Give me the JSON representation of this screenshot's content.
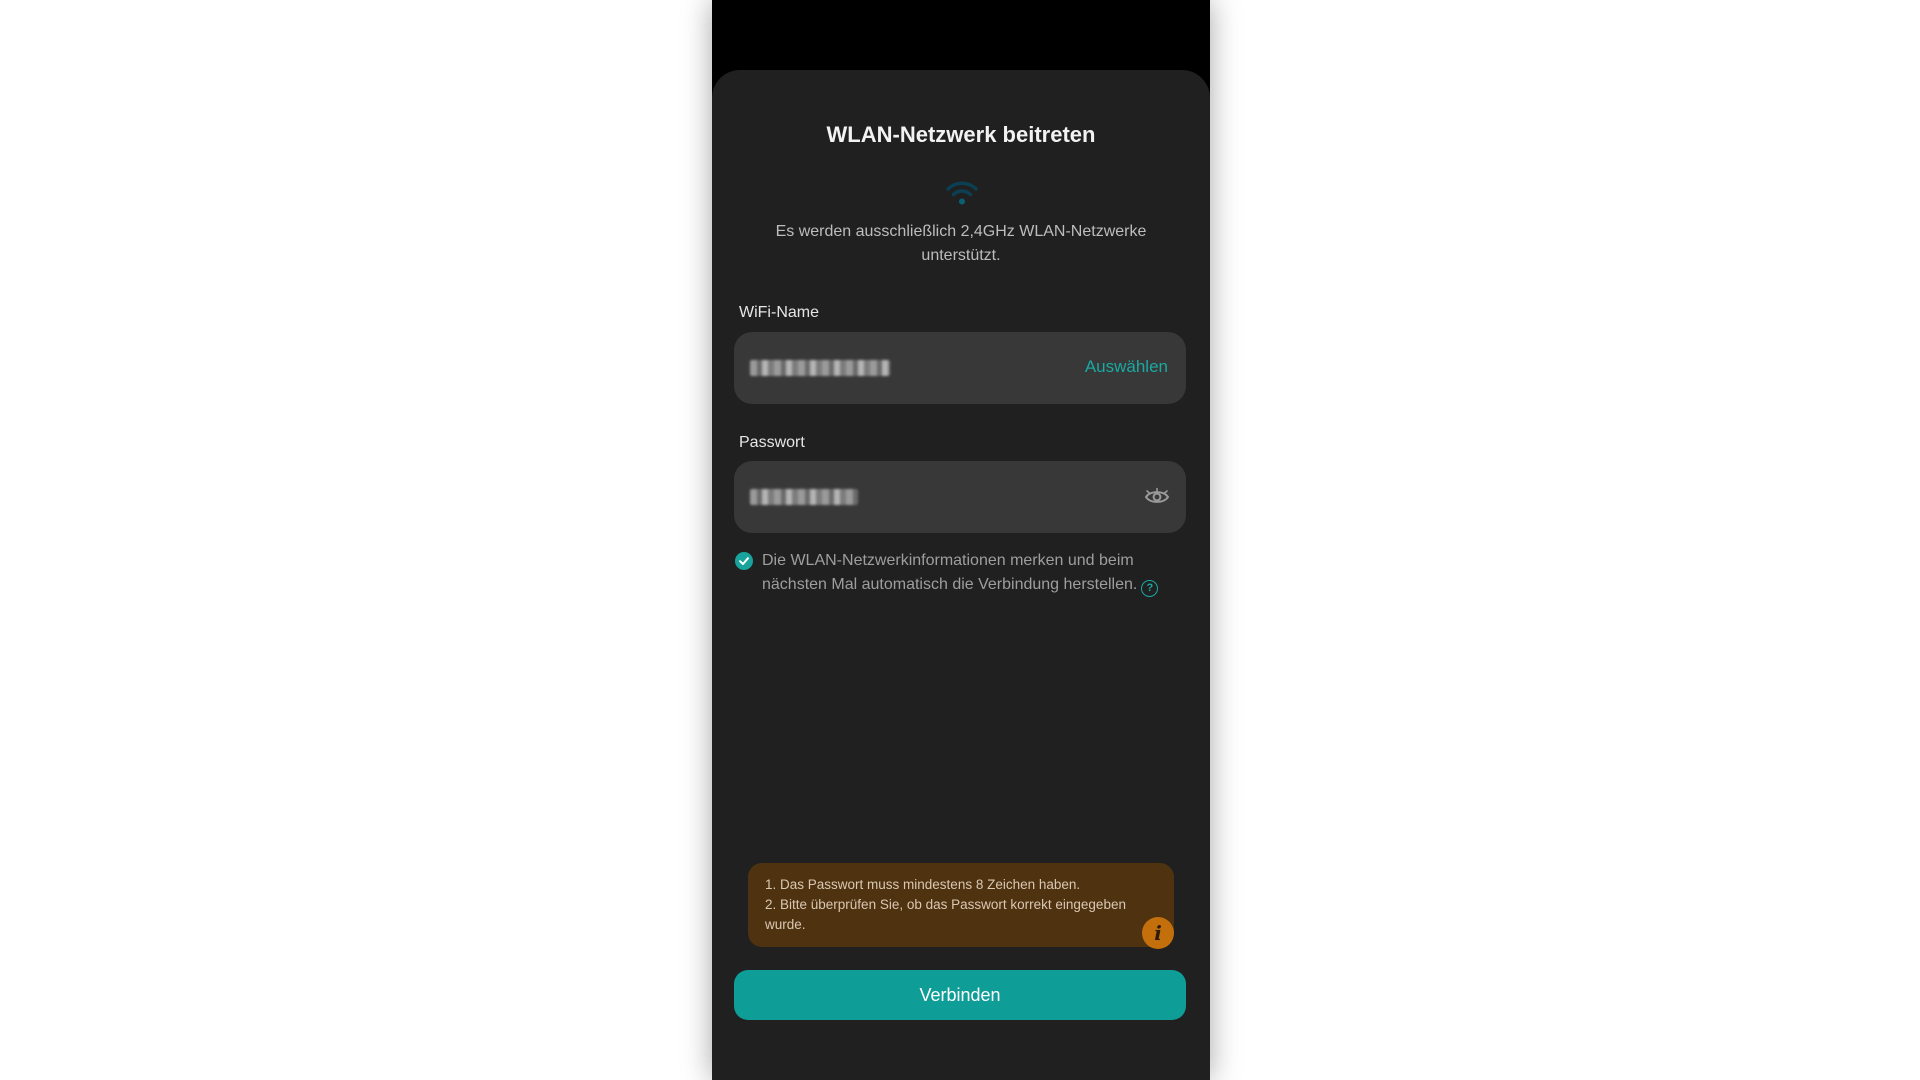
{
  "dialog": {
    "title": "WLAN-Netzwerk beitreten",
    "subtitle": "Es werden ausschließlich 2,4GHz WLAN-Netzwerke unterstützt."
  },
  "wifi_name": {
    "label": "WiFi-Name",
    "select_label": "Auswählen"
  },
  "password": {
    "label": "Passwort"
  },
  "remember": {
    "checked": true,
    "text": "Die WLAN-Netzwerkinformationen merken und beim nächsten Mal automatisch die Verbindung herstellen."
  },
  "hint": {
    "line1": "1. Das Passwort muss mindestens 8 Zeichen haben.",
    "line2": "2. Bitte überprüfen Sie, ob das Passwort korrekt eingegeben wurde."
  },
  "connect_button": {
    "label": "Verbinden"
  },
  "colors": {
    "accent": "#0f9e97",
    "sheet_background": "#202020",
    "field_background": "#383838",
    "hint_background": "#4f3210",
    "info_icon": "#c26f0c"
  }
}
